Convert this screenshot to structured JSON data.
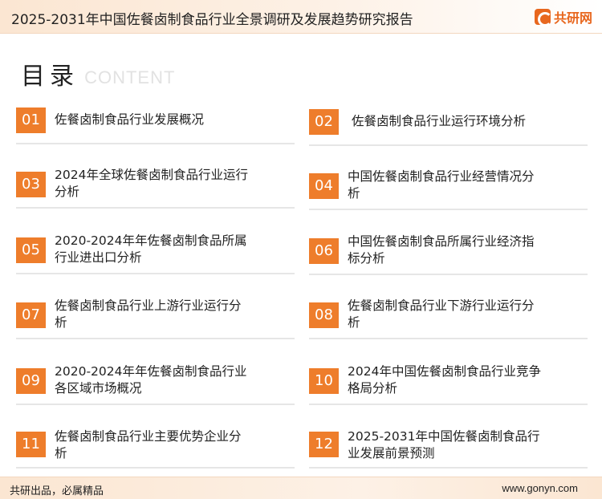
{
  "header": {
    "title": "2025-2031年中国佐餐卤制食品行业全景调研及发展趋势研究报告",
    "logo_text": "共研网"
  },
  "heading": {
    "main": "目录",
    "sub": "CONTENT"
  },
  "colors": {
    "accent": "#ee7d2b",
    "header_bg": "#fbe6d2",
    "divider": "#e6e6e6"
  },
  "items": [
    {
      "num": "01",
      "lines": [
        "佐餐卤制食品行业发展概况",
        ""
      ]
    },
    {
      "num": "02",
      "lines": [
        "佐餐卤制食品行业运行环境分析",
        ""
      ]
    },
    {
      "num": "03",
      "lines": [
        "2024年全球佐餐卤制食品行业运行",
        "分析"
      ]
    },
    {
      "num": "04",
      "lines": [
        "中国佐餐卤制食品行业经营情况分",
        "析"
      ]
    },
    {
      "num": "05",
      "lines": [
        "2020-2024年年佐餐卤制食品所属",
        "行业进出口分析"
      ]
    },
    {
      "num": "06",
      "lines": [
        "中国佐餐卤制食品所属行业经济指",
        "标分析"
      ]
    },
    {
      "num": "07",
      "lines": [
        "佐餐卤制食品行业上游行业运行分",
        "析"
      ]
    },
    {
      "num": "08",
      "lines": [
        "佐餐卤制食品行业下游行业运行分",
        "析"
      ]
    },
    {
      "num": "09",
      "lines": [
        "2020-2024年年佐餐卤制食品行业",
        "各区域市场概况"
      ]
    },
    {
      "num": "10",
      "lines": [
        "2024年中国佐餐卤制食品行业竞争",
        "格局分析"
      ]
    },
    {
      "num": "11",
      "lines": [
        "佐餐卤制食品行业主要优势企业分",
        "析"
      ]
    },
    {
      "num": "12",
      "lines": [
        "2025-2031年中国佐餐卤制食品行",
        "业发展前景预测"
      ]
    }
  ],
  "footer": {
    "left": "共研出品，必属精品",
    "right": "www.gonyn.com"
  }
}
